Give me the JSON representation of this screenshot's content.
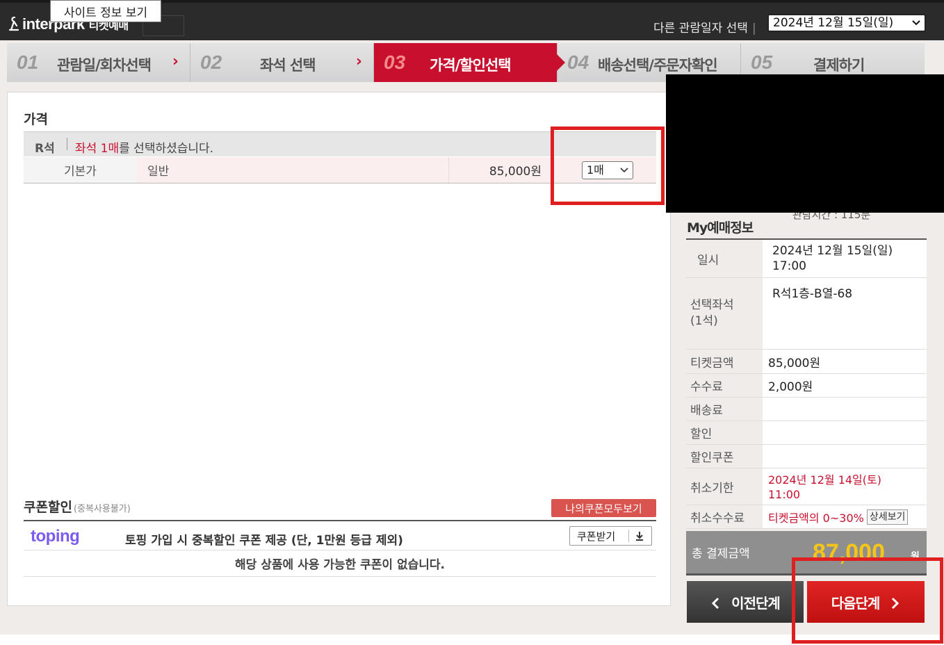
{
  "header": {
    "logo_text": "interpark",
    "logo_sub": "티켓예매",
    "tooltip": "사이트 정보 보기",
    "date_label": "다른 관람일자 선택",
    "date_value": "2024년 12월 15일(일)"
  },
  "steps": [
    {
      "num": "01",
      "label": "관람일/회차선택"
    },
    {
      "num": "02",
      "label": "좌석 선택"
    },
    {
      "num": "03",
      "label": "가격/할인선택"
    },
    {
      "num": "04",
      "label": "배송선택/주문자확인"
    },
    {
      "num": "05",
      "label": "결제하기"
    }
  ],
  "price_section": {
    "title": "가격",
    "grade": "R석",
    "msg_pre": "좌석 1매",
    "msg_post": "를 선택하셨습니다.",
    "base_label": "기본가",
    "type": "일반",
    "price": "85,000원",
    "qty": "1매"
  },
  "coupon_section": {
    "title": "쿠폰할인",
    "note": "(중복사용불가)",
    "my_coupon_button": "나의쿠폰모두보기",
    "toping_logo": "toping",
    "toping_text": "토핑 가입 시 중복할인 쿠폰 제공 (단, 1만원 등급 제외)",
    "coupon_get_button": "쿠폰받기",
    "no_coupon": "해당 상품에 사용 가능한 쿠폰이 없습니다."
  },
  "side": {
    "runtime_peek": "관람시간 : 115분",
    "title": "My예매정보",
    "datetime_label": "일시",
    "datetime_value": "2024년 12월 15일(일)",
    "datetime_time": "17:00",
    "seat_label": "선택좌석",
    "seat_count": "(1석)",
    "seat_value": "R석1층-B열-68",
    "ticket_label": "티켓금액",
    "ticket_value": "85,000원",
    "fee_label": "수수료",
    "fee_value": "2,000원",
    "delivery_label": "배송료",
    "discount_label": "할인",
    "coupon_label": "할인쿠폰",
    "cancel_deadline_label": "취소기한",
    "cancel_deadline_value": "2024년 12월 14일(토)",
    "cancel_deadline_time": "11:00",
    "cancel_fee_label": "취소수수료",
    "cancel_fee_value": "티켓금액의 0~30%",
    "detail_button": "상세보기",
    "total_label": "총 결제금액",
    "total_value": "87,000",
    "total_unit": "원",
    "prev_button": "이전단계",
    "next_button": "다음단계"
  },
  "colors": {
    "accent": "#c8102e",
    "highlight": "#e02020",
    "total_amount": "#f5c518"
  }
}
